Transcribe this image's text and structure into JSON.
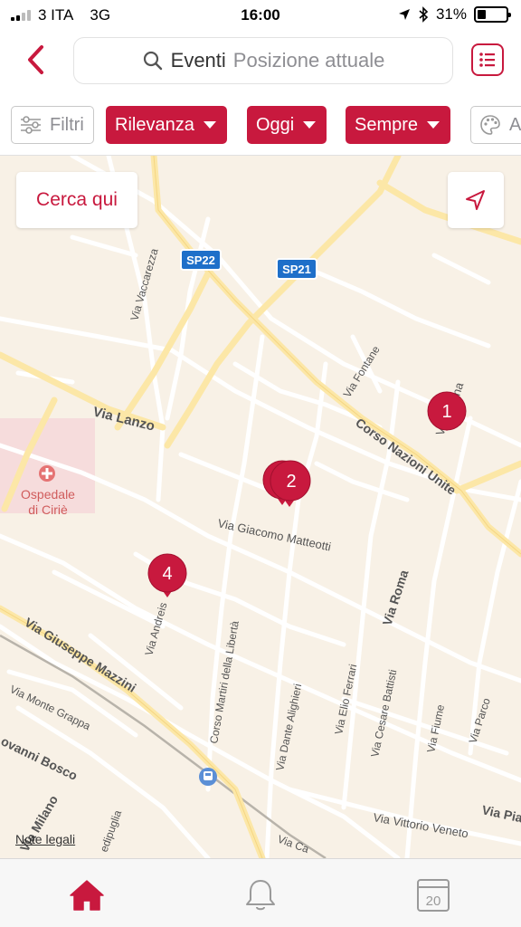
{
  "status_bar": {
    "carrier": "3 ITA",
    "network": "3G",
    "time": "16:00",
    "battery_percent": "31%",
    "battery_level": 0.31,
    "signal_bars": 2
  },
  "header": {
    "back_icon": "chevron-left-icon",
    "search_query": "Eventi",
    "search_location": "Posizione attuale",
    "list_view_icon": "list-icon"
  },
  "filters": {
    "filter_label": "Filtri",
    "chips": [
      "Rilevanza",
      "Oggi",
      "Sempre"
    ],
    "partial_label": "A"
  },
  "map": {
    "search_here_label": "Cerca qui",
    "legal_label": "Note legali",
    "pins": [
      "1",
      "2",
      "4"
    ],
    "shields": [
      "SP22",
      "SP21"
    ],
    "hospital": [
      "Ospedale",
      "di Ciriè"
    ],
    "labels": {
      "via_lanzo": "Via Lanzo",
      "via_vaccarezza": "Via Vaccarezza",
      "via_fontane": "Via Fontane",
      "corso_nazioni_unite": "Corso Nazioni Unite",
      "via_top_right": "Via",
      "via_top_right_suffix": "na",
      "via_giacomo_matteotti": "Via Giacomo Matteotti",
      "via_roma": "Via Roma",
      "via_andreis": "Via Andreis",
      "via_giuseppe_mazzini": "Via Giuseppe Mazzini",
      "via_monte_grappa": "Via Monte Grappa",
      "corso_martiri": "Corso Martiri della Libertà",
      "via_dante_alighieri": "Via Dante Alighieri",
      "via_elio_ferrari": "Via Elio Ferrari",
      "via_cesare_battisti": "Via Cesare Battisti",
      "via_fiume": "Via Fiume",
      "via_parco": "Via Parco",
      "giovanni_bosco": "ovanni Bosco",
      "via_milano": "Via Milano",
      "via_piave": "Via Pia",
      "via_vittorio_veneto": "Via Vittorio Veneto",
      "via_ca": "Via Ca",
      "edipuglia": "edipuglia"
    }
  },
  "tabbar": {
    "home_icon": "home-icon",
    "notifications_icon": "bell-icon",
    "calendar_icon": "calendar-icon",
    "calendar_day": "20"
  },
  "colors": {
    "accent": "#c8193e",
    "map_background": "#f8f1e6",
    "major_road": "#fce7a7",
    "minor_road": "#ffffff"
  }
}
